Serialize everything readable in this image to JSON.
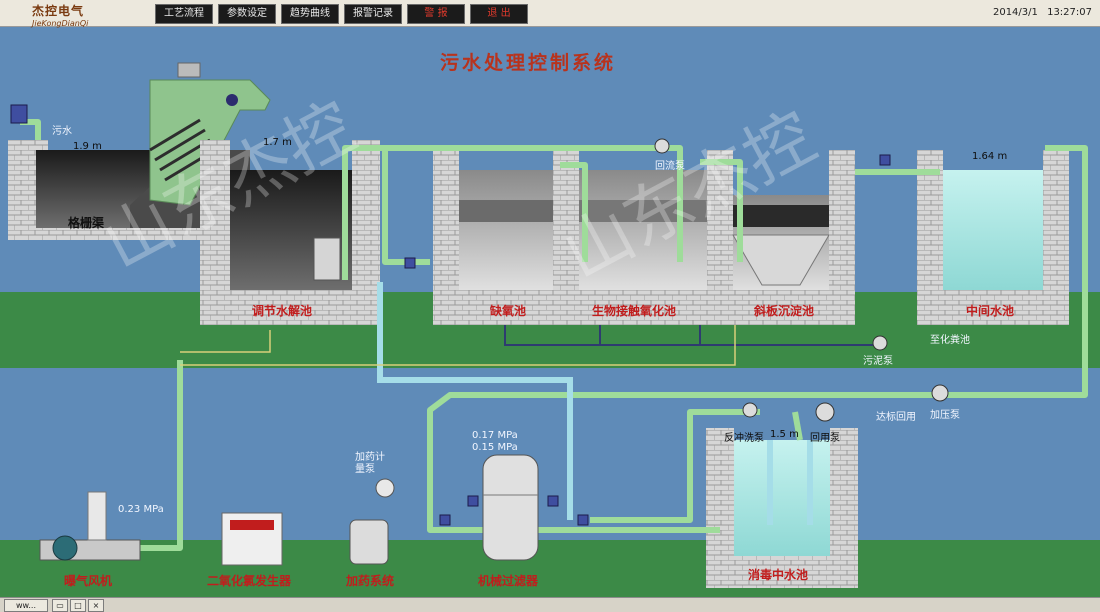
{
  "app": {
    "brand": "杰控电气",
    "brand_en": "JieKongDianQi",
    "datetime_date": "2014/3/1",
    "datetime_time": "13:27:07"
  },
  "menu": {
    "process": "工艺流程",
    "params": "参数设定",
    "trend": "趋势曲线",
    "alarm": "报警记录",
    "warn": "警 报",
    "exit": "退 出"
  },
  "title": "污水处理控制系统",
  "labels": {
    "grid_pool": "格栅渠",
    "adjust_pool": "调节水解池",
    "anoxic_pool": "缺氧池",
    "bio_pool": "生物接触氧化池",
    "settle_pool": "斜板沉淀池",
    "mid_pool": "中间水池",
    "blower": "曝气风机",
    "chlorine_gen": "二氧化氯发生器",
    "dosing_system": "加药系统",
    "filter": "机械过滤器",
    "disinfect_pool": "消毒中水池"
  },
  "small_labels": {
    "sewage": "污水",
    "return_pump": "回流泵",
    "sludge_pump": "污泥泵",
    "to_septic": "至化粪池",
    "booster_pump": "加压泵",
    "reuse": "达标回用",
    "backwash_pump": "反冲洗泵",
    "reuse_pump": "回用泵",
    "dosing_pump": "加药计量泵"
  },
  "readings": {
    "grid_level": "1.9 m",
    "adjust_level": "1.7 m",
    "mid_level": "1.64 m",
    "disinfect_level": "1.5 m",
    "pressure_in": "0.17 MPa",
    "pressure_out": "0.15 MPa",
    "blower_pressure": "0.23 MPa"
  },
  "taskbar": {
    "item1": "ww..."
  },
  "colors": {
    "pipe_green": "#9fdc9a",
    "pipe_blue": "#a5dde8",
    "ground": "#3c8a47",
    "sky": "#5f8bb8",
    "label_red": "#c11d1d",
    "water": "#a8e3e0"
  }
}
